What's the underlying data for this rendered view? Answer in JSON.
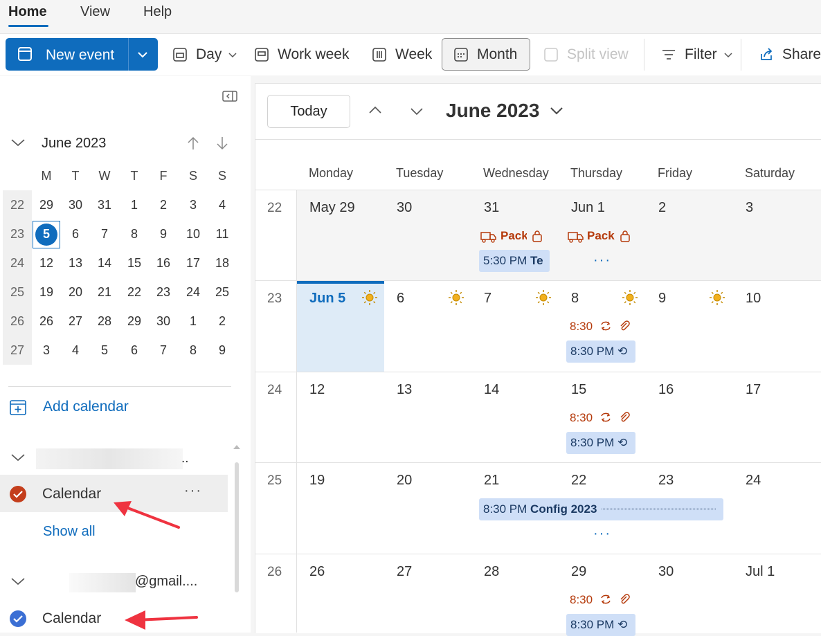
{
  "top_tabs": [
    "Home",
    "View",
    "Help"
  ],
  "ribbon": {
    "new_event": "New event",
    "day": "Day",
    "work_week": "Work week",
    "week": "Week",
    "month": "Month",
    "split_view": "Split view",
    "filter": "Filter",
    "share": "Share"
  },
  "mini_calendar": {
    "title": "June 2023",
    "weekday_headers": [
      "M",
      "T",
      "W",
      "T",
      "F",
      "S",
      "S"
    ],
    "weeks": [
      {
        "wk": "22",
        "days": [
          "29",
          "30",
          "31",
          "1",
          "2",
          "3",
          "4"
        ]
      },
      {
        "wk": "23",
        "days": [
          "5",
          "6",
          "7",
          "8",
          "9",
          "10",
          "11"
        ]
      },
      {
        "wk": "24",
        "days": [
          "12",
          "13",
          "14",
          "15",
          "16",
          "17",
          "18"
        ]
      },
      {
        "wk": "25",
        "days": [
          "19",
          "20",
          "21",
          "22",
          "23",
          "24",
          "25"
        ]
      },
      {
        "wk": "26",
        "days": [
          "26",
          "27",
          "28",
          "29",
          "30",
          "1",
          "2"
        ]
      },
      {
        "wk": "27",
        "days": [
          "3",
          "4",
          "5",
          "6",
          "7",
          "8",
          "9"
        ]
      }
    ],
    "selected": "5"
  },
  "sidebar": {
    "add_calendar": "Add calendar",
    "account1_suffix": "..",
    "calendar1": "Calendar",
    "show_all": "Show all",
    "account2_suffix": "@gmail....",
    "calendar2": "Calendar"
  },
  "main": {
    "today": "Today",
    "title": "June 2023",
    "day_headers": [
      "Monday",
      "Tuesday",
      "Wednesday",
      "Thursday",
      "Friday",
      "Saturday"
    ],
    "weeks": [
      {
        "wk": "22",
        "days": [
          "May 29",
          "30",
          "31",
          "Jun 1",
          "2",
          "3"
        ]
      },
      {
        "wk": "23",
        "days": [
          "Jun 5",
          "6",
          "7",
          "8",
          "9",
          "10"
        ]
      },
      {
        "wk": "24",
        "days": [
          "12",
          "13",
          "14",
          "15",
          "16",
          "17"
        ]
      },
      {
        "wk": "25",
        "days": [
          "19",
          "20",
          "21",
          "22",
          "23",
          "24"
        ]
      },
      {
        "wk": "26",
        "days": [
          "26",
          "27",
          "28",
          "29",
          "30",
          "Jul 1"
        ]
      }
    ],
    "events": {
      "pack1": "Pack",
      "pack2": "Pack",
      "test_time": "5:30 PM",
      "test_title": "Te",
      "t830_a": "8:30",
      "t830pm_a": "8:30 PM",
      "t830_b": "8:30",
      "t830pm_b": "8:30 PM",
      "config_time": "8:30 PM",
      "config_title": "Config 2023",
      "t830_c": "8:30",
      "t830pm_c": "8:30 PM"
    },
    "more_dots": "···"
  },
  "colors": {
    "accent": "#0f6cbd",
    "event_blue": "#cfdff7",
    "event_orange": "#b53a0b",
    "cal1": "#c43e1c",
    "cal2": "#3b6fd4"
  }
}
